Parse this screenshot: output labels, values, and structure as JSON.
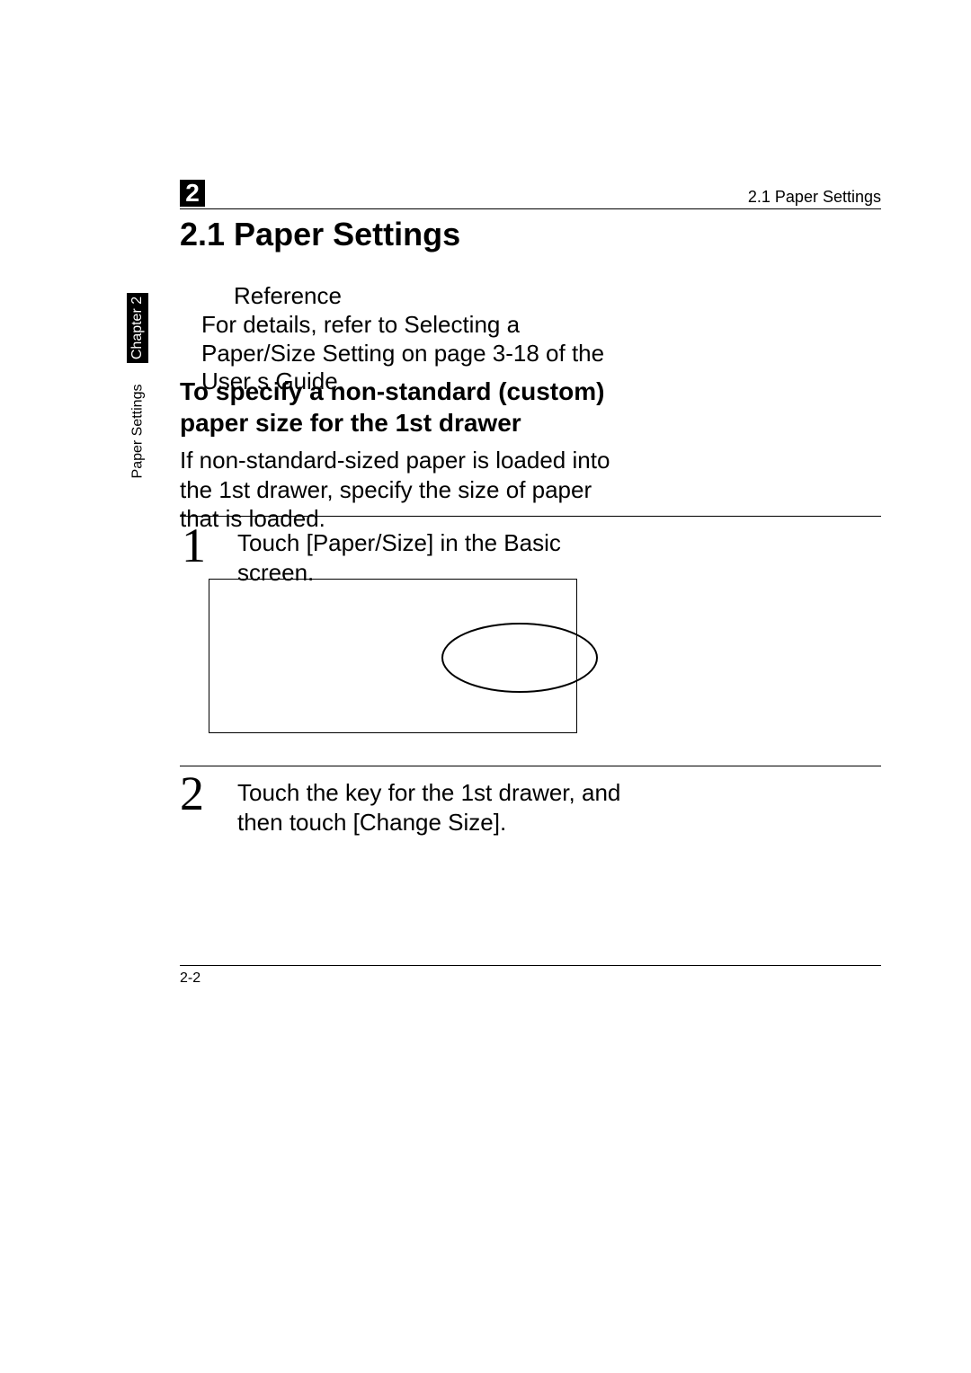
{
  "chapter_num": "2",
  "header_right": "2.1 Paper Settings",
  "section_title": "2.1  Paper Settings",
  "reference_label": "Reference",
  "reference_body": "For details, refer to  Selecting a Paper/Size Setting  on page 3-18 of the User s Guide.",
  "sub_title": "To specify a non-standard (custom) paper size for the 1st drawer",
  "intro": "If non-standard-sized paper is loaded into the 1st drawer, specify the size of paper that is loaded.",
  "step1_num": "1",
  "step1_text": "Touch [Paper/Size] in the Basic screen.",
  "step2_num": "2",
  "step2_text": "Touch the key for the 1st drawer, and then touch [Change Size].",
  "footer_page": "2-2",
  "side_tab": "Chapter 2",
  "side_label": "Paper Settings"
}
